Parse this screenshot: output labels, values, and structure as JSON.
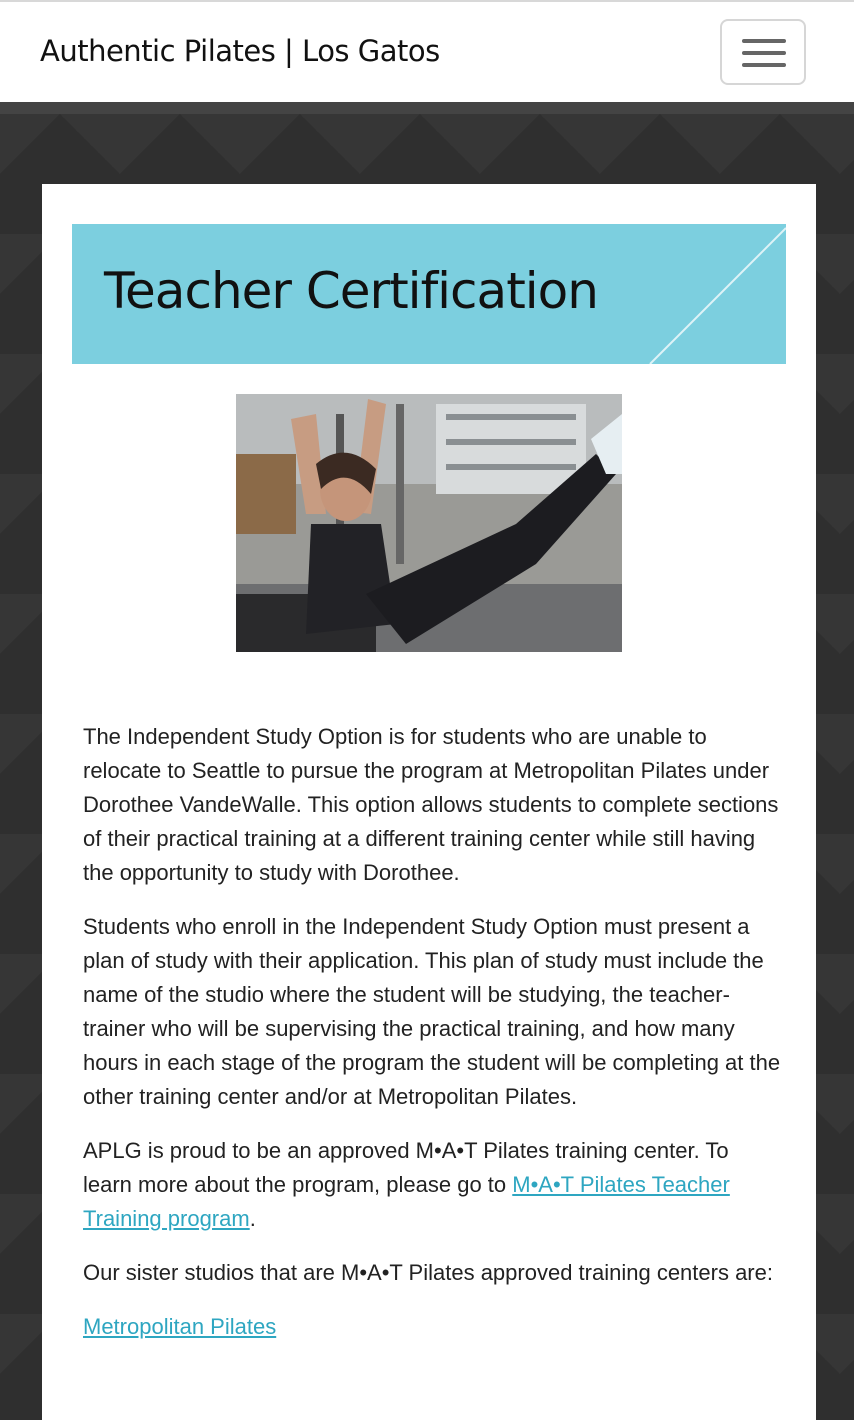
{
  "navbar": {
    "brand": "Authentic Pilates | Los Gatos",
    "menu_icon": "hamburger-menu-icon"
  },
  "page": {
    "title": "Teacher Certification"
  },
  "photo": {
    "description": "woman doing pilates exercise"
  },
  "content": {
    "p1": "The Independent Study Option is for students who are unable to relocate to Seattle to pursue the program at Metropolitan Pilates under Dorothee VandeWalle. This option allows students to complete sections of their practical training at a different training center while still having the opportunity to study with Dorothee.",
    "p2": "Students who enroll in the Independent Study Option must present a plan of study with their application. This plan of study must include the name of the studio where the student will be studying, the teacher-trainer who will be supervising the practical training, and how many hours in each stage of the program the student will be completing at the other training center and/or at Metropolitan Pilates.",
    "p3_before": "APLG is proud to be an approved M•A•T Pilates training center. To learn more about the program, please go to ",
    "p3_link": "M•A•T Pilates Teacher Training program",
    "p3_after": ".",
    "p4": "Our sister studios that are M•A•T Pilates approved training centers are:",
    "link_metropolitan": "Metropolitan Pilates"
  },
  "colors": {
    "banner": "#7ccfdf",
    "link": "#2ea6c1",
    "background": "#2e2e2e"
  }
}
